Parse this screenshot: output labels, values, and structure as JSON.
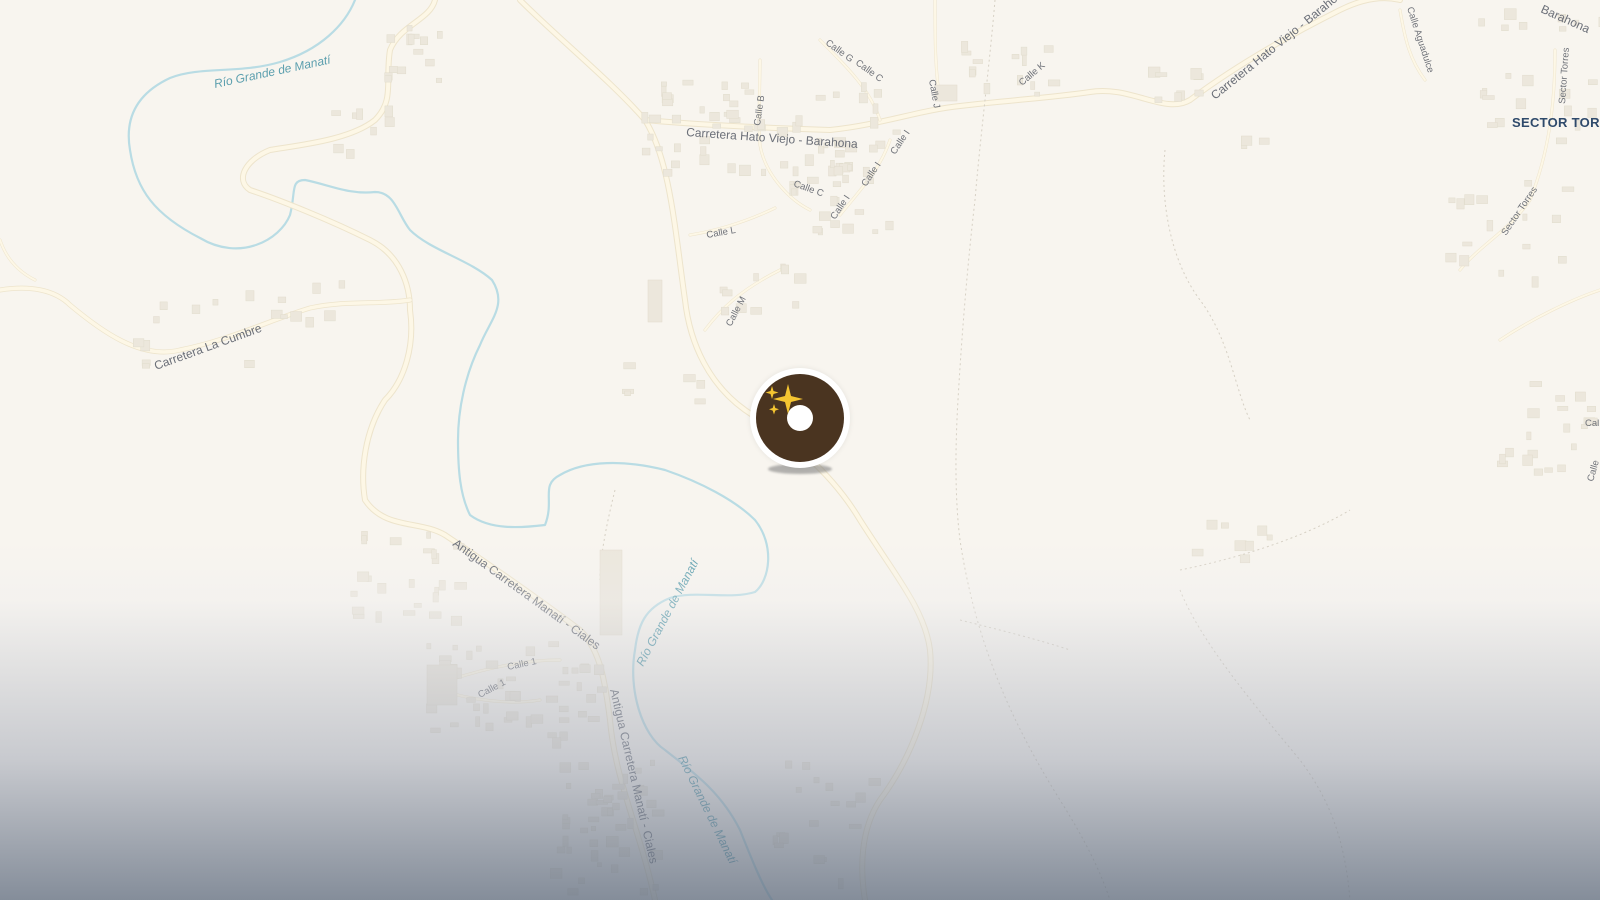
{
  "map": {
    "labels": {
      "rio_1": "Río Grande de Manatí",
      "rio_2": "Río Grande de Manatí",
      "rio_3": "Río Grande de Manatí",
      "hato_viejo_1": "Carretera Hato Viejo - Barahona",
      "hato_viejo_2": "Carretera Hato Viejo - Barahona",
      "barahona_edge": "Barahona",
      "la_cumbre": "Carretera La Cumbre",
      "antigua_1": "Antigua Carretera Manatí - Ciales",
      "antigua_2": "Antigua Carretera Manatí - Ciales",
      "calle_b": "Calle B",
      "calle_g": "Calle G",
      "calle_c1": "Calle C",
      "calle_c2": "Calle C",
      "calle_j": "Calle J",
      "calle_k": "Calle K",
      "calle_i1": "Calle I",
      "calle_i2": "Calle I",
      "calle_i3": "Calle I",
      "calle_l": "Calle L",
      "calle_m": "Calle M",
      "calle_1a": "Calle 1",
      "calle_1b": "Calle 1",
      "calle_acueducto": "Calle Aguadulce",
      "sector_torres_v": "Sector Torres",
      "sector_torres_r": "Sector Torres",
      "sector_torres_big": "SECTOR TORR",
      "calle_edge_1": "Cal",
      "calle_edge_2": "Calle"
    }
  },
  "marker": {
    "icon": "sparkles-icon",
    "colors": {
      "core": "#4a3420",
      "sparkle": "#f5c531",
      "halo": "#ffffff"
    }
  },
  "colors": {
    "background": "#f8f5ef",
    "road": "#fdf7e6",
    "river": "#b9dce4",
    "river_label": "#5c9fae",
    "road_label": "#6b6f78",
    "sector_label": "#2f4a6b"
  }
}
